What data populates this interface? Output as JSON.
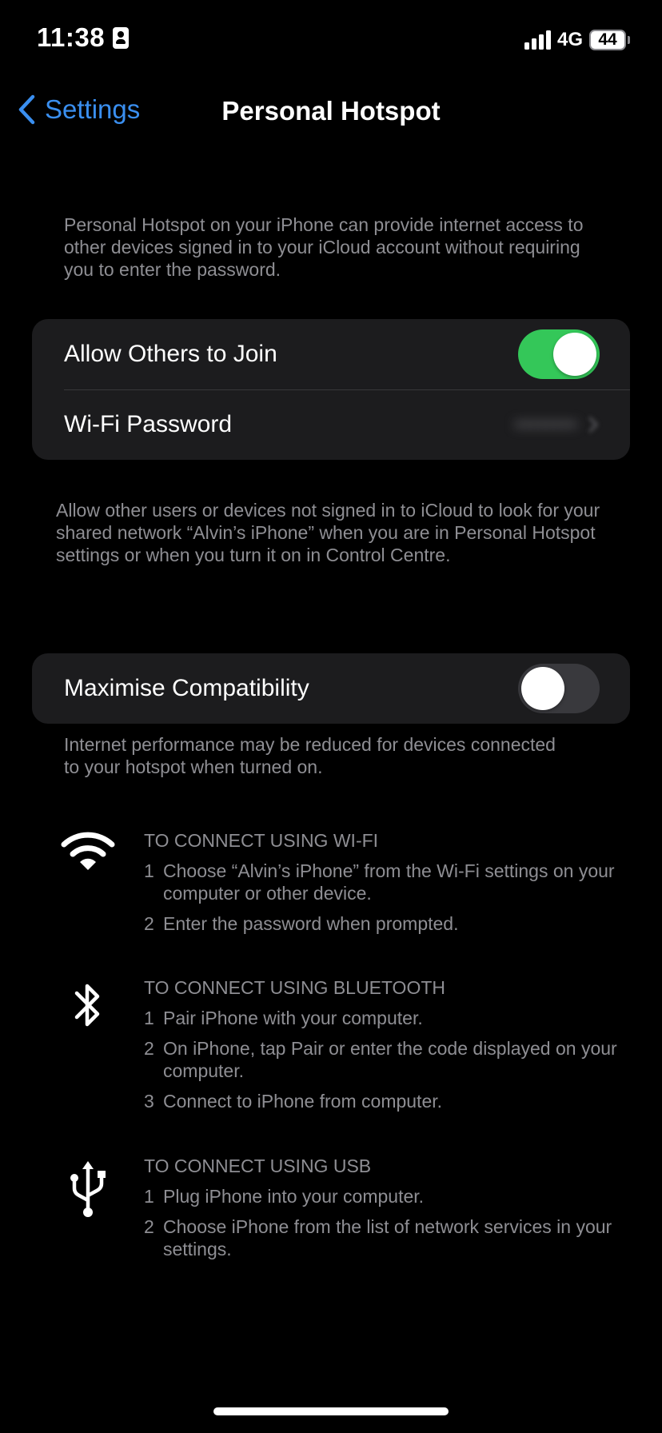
{
  "status_bar": {
    "time": "11:38",
    "network": "4G",
    "battery_level": "44"
  },
  "nav": {
    "back_label": "Settings",
    "title": "Personal Hotspot"
  },
  "intro_text": "Personal Hotspot on your iPhone can provide internet access to other devices signed in to your iCloud account without requiring you to enter the password.",
  "group1": {
    "allow_others_label": "Allow Others to Join",
    "allow_others_on": true,
    "wifi_password_label": "Wi-Fi Password",
    "wifi_password_value": "••••••••"
  },
  "allow_others_footer": "Allow other users or devices not signed in to iCloud to look for your shared network “Alvin’s iPhone” when you are in Personal Hotspot settings or when you turn it on in Control Centre.",
  "group2": {
    "max_compat_label": "Maximise Compatibility",
    "max_compat_on": false
  },
  "max_compat_footer": "Internet performance may be reduced for devices connected to your hotspot when turned on.",
  "instructions": {
    "wifi": {
      "icon": "wifi-icon",
      "heading": "TO CONNECT USING WI-FI",
      "steps": [
        {
          "num": "1",
          "text": "Choose “Alvin’s iPhone” from the Wi-Fi settings on your computer or other device."
        },
        {
          "num": "2",
          "text": "Enter the password when prompted."
        }
      ]
    },
    "bluetooth": {
      "icon": "bluetooth-icon",
      "heading": "TO CONNECT USING BLUETOOTH",
      "steps": [
        {
          "num": "1",
          "text": "Pair iPhone with your computer."
        },
        {
          "num": "2",
          "text": "On iPhone, tap Pair or enter the code displayed on your computer."
        },
        {
          "num": "3",
          "text": "Connect to iPhone from computer."
        }
      ]
    },
    "usb": {
      "icon": "usb-icon",
      "heading": "TO CONNECT USING USB",
      "steps": [
        {
          "num": "1",
          "text": "Plug iPhone into your computer."
        },
        {
          "num": "2",
          "text": "Choose iPhone from the list of network services in your settings."
        }
      ]
    }
  },
  "colors": {
    "accent": "#3a8ff0",
    "toggle_on": "#34c759",
    "group_bg": "#1c1c1e",
    "secondary_text": "#8e8e93"
  }
}
